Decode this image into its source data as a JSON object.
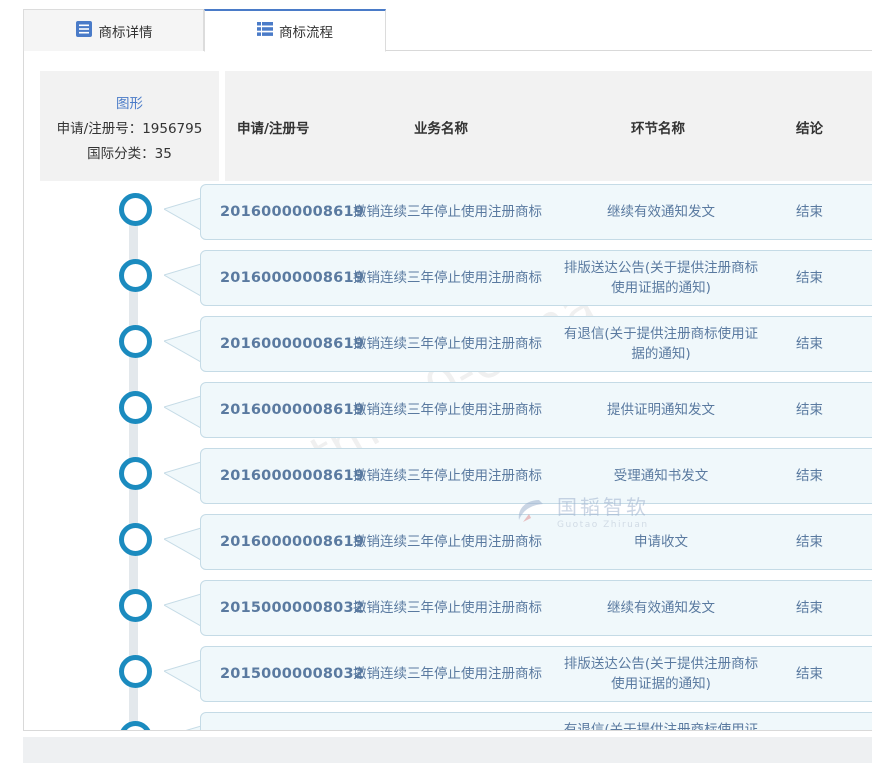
{
  "tabs": [
    {
      "label": "商标详情",
      "icon": "document-list-icon",
      "active": false
    },
    {
      "label": "商标流程",
      "icon": "list-icon",
      "active": true
    }
  ],
  "info": {
    "shape_label": "图形",
    "reg_no": "申请/注册号：1956795",
    "intl_class": "国际分类：35"
  },
  "columns": {
    "reg_no": "申请/注册号",
    "business": "业务名称",
    "step": "环节名称",
    "result": "结论"
  },
  "rows": [
    {
      "reg_no": "20160000008619",
      "business": "撤销连续三年停止使用注册商标",
      "step": "继续有效通知发文",
      "result": "结束"
    },
    {
      "reg_no": "20160000008619",
      "business": "撤销连续三年停止使用注册商标",
      "step": "排版送达公告(关于提供注册商标使用证据的通知)",
      "result": "结束"
    },
    {
      "reg_no": "20160000008619",
      "business": "撤销连续三年停止使用注册商标",
      "step": "有退信(关于提供注册商标使用证据的通知)",
      "result": "结束"
    },
    {
      "reg_no": "20160000008619",
      "business": "撤销连续三年停止使用注册商标",
      "step": "提供证明通知发文",
      "result": "结束"
    },
    {
      "reg_no": "20160000008619",
      "business": "撤销连续三年停止使用注册商标",
      "step": "受理通知书发文",
      "result": "结束"
    },
    {
      "reg_no": "20160000008619",
      "business": "撤销连续三年停止使用注册商标",
      "step": "申请收文",
      "result": "结束"
    },
    {
      "reg_no": "20150000008032",
      "business": "撤销连续三年停止使用注册商标",
      "step": "继续有效通知发文",
      "result": "结束"
    },
    {
      "reg_no": "20150000008032",
      "business": "撤销连续三年停止使用注册商标",
      "step": "排版送达公告(关于提供注册商标使用证据的通知)",
      "result": "结束"
    },
    {
      "reg_no": "",
      "business": "",
      "step": "有退信(关于提供注册商标使用证据的通知)",
      "result": ""
    }
  ],
  "watermark": {
    "text": "tm100-china",
    "brand_cn": "国韬智软",
    "brand_en": "Guotao Zhiruan"
  },
  "colors": {
    "accent": "#4a7bc8",
    "timeline_circle": "#1b8bbf",
    "row_text": "#5a7aa0",
    "card_bg": "#f0f8fb"
  }
}
